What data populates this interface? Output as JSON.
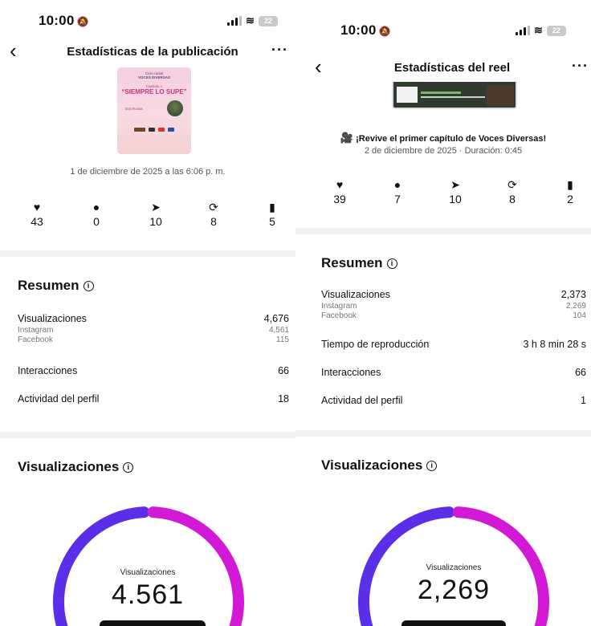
{
  "colors": {
    "gauge_start": "#5b2ee8",
    "gauge_end": "#d21ad6",
    "divider": "#f2f2f2"
  },
  "left": {
    "status": {
      "time": "10:00",
      "battery": "22"
    },
    "header": {
      "back_icon": "chevron-left-icon",
      "title": "Estadísticas de la publicación",
      "more_label": "···"
    },
    "post_thumbnail": {
      "series_line": "Ciclo radial",
      "program": "VOCES DIVERSAS",
      "chapter": "Capítulo 1",
      "headline": "“SIEMPRE LO SUPE”",
      "guest": "Eva Rosas"
    },
    "date": "1 de diciembre de 2025 a las 6:06 p. m.",
    "metrics": [
      {
        "icon": "heart-icon",
        "glyph": "♥",
        "value": "43"
      },
      {
        "icon": "comment-icon",
        "glyph": "●",
        "value": "0"
      },
      {
        "icon": "share-icon",
        "glyph": "➤",
        "value": "10"
      },
      {
        "icon": "repost-icon",
        "glyph": "⟳",
        "value": "8"
      },
      {
        "icon": "bookmark-icon",
        "glyph": "▮",
        "value": "5"
      }
    ],
    "summary": {
      "title": "Resumen",
      "views_label": "Visualizaciones",
      "views_value": "4,676",
      "instagram_label": "Instagram",
      "instagram_value": "4,561",
      "facebook_label": "Facebook",
      "facebook_value": "115",
      "interactions_label": "Interacciones",
      "interactions_value": "66",
      "profile_label": "Actividad del perfil",
      "profile_value": "18"
    },
    "views_section": {
      "title": "Visualizaciones",
      "gauge_label": "Visualizaciones",
      "gauge_value": "4.561",
      "instagram_share": 0.975
    }
  },
  "right": {
    "status": {
      "time": "10:00",
      "battery": "22"
    },
    "header": {
      "back_icon": "chevron-left-icon",
      "title": "Estadísticas del reel",
      "more_label": "···"
    },
    "caption": "¡Revive el primer capítulo de Voces Diversas!",
    "meta": "2 de diciembre de 2025 · Duración: 0:45",
    "metrics": [
      {
        "icon": "heart-icon",
        "glyph": "♥",
        "value": "39"
      },
      {
        "icon": "comment-icon",
        "glyph": "●",
        "value": "7"
      },
      {
        "icon": "share-icon",
        "glyph": "➤",
        "value": "10"
      },
      {
        "icon": "repost-icon",
        "glyph": "⟳",
        "value": "8"
      },
      {
        "icon": "bookmark-icon",
        "glyph": "▮",
        "value": "2"
      }
    ],
    "summary": {
      "title": "Resumen",
      "views_label": "Visualizaciones",
      "views_value": "2,373",
      "instagram_label": "Instagram",
      "instagram_value": "2,269",
      "facebook_label": "Facebook",
      "facebook_value": "104",
      "playtime_label": "Tiempo de reproducción",
      "playtime_value": "3 h 8 min 28 s",
      "interactions_label": "Interacciones",
      "interactions_value": "66",
      "profile_label": "Actividad del perfil",
      "profile_value": "1"
    },
    "views_section": {
      "title": "Visualizaciones",
      "gauge_label": "Visualizaciones",
      "gauge_value": "2,269",
      "instagram_share": 0.956
    }
  }
}
